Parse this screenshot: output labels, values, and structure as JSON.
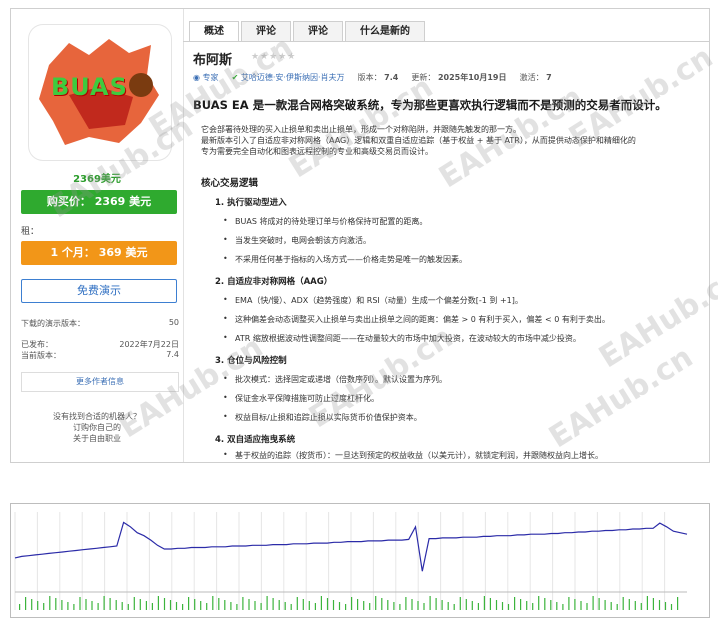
{
  "left": {
    "logo_text": "BUAS",
    "price_small": "2369美元",
    "buy_button": "购买价：   2369 美元",
    "rent_label": "租：",
    "rent_button": "1 个月：   369 美元",
    "demo_button": "免费演示",
    "info": [
      {
        "label": "下载的演示版本：",
        "value": "50"
      },
      {
        "label": "已发布：",
        "value": "2022年7月22日"
      },
      {
        "label": "当前版本：",
        "value": "7.4"
      }
    ],
    "more_button": "更多作者信息",
    "hint_lines": [
      "没有找到合适的机器人？",
      "订购你自己的",
      "关于自由职业"
    ]
  },
  "tabs": [
    "概述",
    "评论",
    "评论",
    "什么是新的"
  ],
  "product": {
    "title": "布阿斯",
    "stars": "★★★★★",
    "author_role": "专家",
    "author_name": "艾哈迈德·安·伊斯纳因·肖夫万",
    "version_label": "版本：",
    "version_value": "7.4",
    "updated_label": "更新：",
    "updated_value": "2025年10月19日",
    "activations_label": "激活：",
    "activations_value": "7"
  },
  "description": {
    "headline": "BUAS EA 是一款混合网格突破系统，专为那些更喜欢执行逻辑而不是预测的交易者而设计。",
    "intro": [
      "它会部署待处理的买入止损单和卖出止损单，形成一个对称陷阱，并跟随先触发的那一方。",
      "最新版本引入了自适应非对称网格（AAG）逻辑和双重自适应追踪（基于权益 + 基于 ATR），从而提供动态保护和精细化的",
      "专为需要完全自动化和图表远程控制的专业和高级交易员而设计。"
    ],
    "core_heading": "核心交易逻辑",
    "sections": [
      {
        "title": "1. 执行驱动型进入",
        "bullets": [
          "BUAS 将成对的待处理订单与价格保持可配置的距离。",
          "当发生突破时，电网会朝该方向激活。",
          "不采用任何基于指标的入场方式——价格走势是唯一的触发因素。"
        ]
      },
      {
        "title": "2. 自适应非对称网格（AAG）",
        "bullets": [
          "EMA（快/慢）、ADX（趋势强度）和 RSI（动量）生成一个偏差分数[-1 到 +1]。",
          "这种偏差会动态调整买入止损单与卖出止损单之间的距离：偏差 > 0 有利于买入，偏差 < 0 有利于卖出。",
          "ATR 缩放根据波动性调整间距——在动量较大的市场中加大投资，在波动较大的市场中减少投资。"
        ]
      },
      {
        "title": "3. 仓位与风险控制",
        "bullets": [
          "批次模式：选择固定或递增（倍数序列）。默认设置为序列。",
          "保证金水平保障措施可防止过度杠杆化。",
          "权益目标/止损和追踪止损以实际货币价值保护资本。"
        ]
      },
      {
        "title": "4. 双自适应拖曳系统",
        "bullets": [
          "基于权益的追踪（按货币）：一旦达到预定的权益收益（以美元计），就锁定利润，并跟随权益向上增长。"
        ]
      }
    ]
  },
  "watermark": "EAHub.cn",
  "chart_data": {
    "type": "line",
    "series": [
      {
        "values": [
          0.38,
          0.4,
          0.41,
          0.42,
          0.43,
          0.44,
          0.45,
          0.46,
          0.47,
          0.48,
          0.49,
          0.5,
          0.51,
          0.52,
          0.53,
          0.54,
          0.86,
          0.8,
          0.72,
          0.68,
          0.62,
          0.55,
          0.5,
          0.5,
          0.51,
          0.51,
          0.52,
          0.52,
          0.52,
          0.53,
          0.53,
          0.53,
          0.54,
          0.54,
          0.54,
          0.55,
          0.55,
          0.55,
          0.56,
          0.56,
          0.56,
          0.57,
          0.57,
          0.57,
          0.58,
          0.58,
          0.58,
          0.59,
          0.59,
          0.6,
          0.6,
          0.6,
          0.61,
          0.61,
          0.61,
          0.62,
          0.62,
          0.62,
          0.63,
          0.8,
          0.2,
          0.64,
          0.64,
          0.65,
          0.65,
          0.65,
          0.66,
          0.66,
          0.66,
          0.67,
          0.67,
          0.68,
          0.68,
          0.68,
          0.69,
          0.69,
          0.7,
          0.7,
          0.7,
          0.71,
          0.71,
          0.72,
          0.72,
          0.73,
          0.73,
          0.74,
          0.74,
          0.75,
          0.75,
          0.76,
          0.76,
          0.77,
          0.77,
          0.78,
          0.78,
          0.85,
          0.8,
          0.74,
          0.72,
          0.7
        ]
      }
    ],
    "ylim": [
      0,
      1
    ]
  }
}
